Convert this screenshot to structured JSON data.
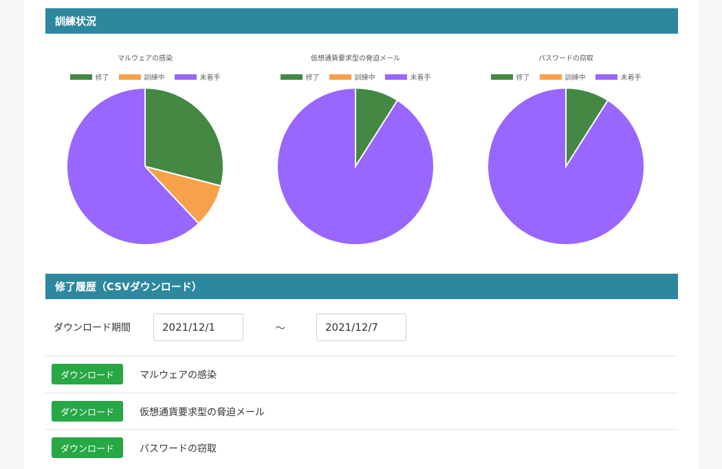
{
  "training_status": {
    "header": "訓練状況",
    "legend": [
      "修了",
      "訓練中",
      "未着手"
    ],
    "colors": {
      "completed": "#448844",
      "in_progress": "#f8a14b",
      "not_started": "#9966ff"
    }
  },
  "chart_data": [
    {
      "type": "pie",
      "title": "マルウェアの感染",
      "labels": [
        "修了",
        "訓練中",
        "未着手"
      ],
      "values": [
        29,
        9,
        62
      ]
    },
    {
      "type": "pie",
      "title": "仮想通貨要求型の脅迫メール",
      "labels": [
        "修了",
        "訓練中",
        "未着手"
      ],
      "values": [
        9,
        0,
        91
      ]
    },
    {
      "type": "pie",
      "title": "パスワードの窃取",
      "labels": [
        "修了",
        "訓練中",
        "未着手"
      ],
      "values": [
        9,
        0,
        91
      ]
    }
  ],
  "history": {
    "header": "修了履歴（CSVダウンロード）",
    "period_label": "ダウンロード期間",
    "start_date": "2021/12/1",
    "end_date": "2021/12/7",
    "separator": "～",
    "rows": [
      {
        "button": "ダウンロード",
        "label": "マルウェアの感染"
      },
      {
        "button": "ダウンロード",
        "label": "仮想通貨要求型の脅迫メール"
      },
      {
        "button": "ダウンロード",
        "label": "パスワードの窃取"
      }
    ]
  }
}
